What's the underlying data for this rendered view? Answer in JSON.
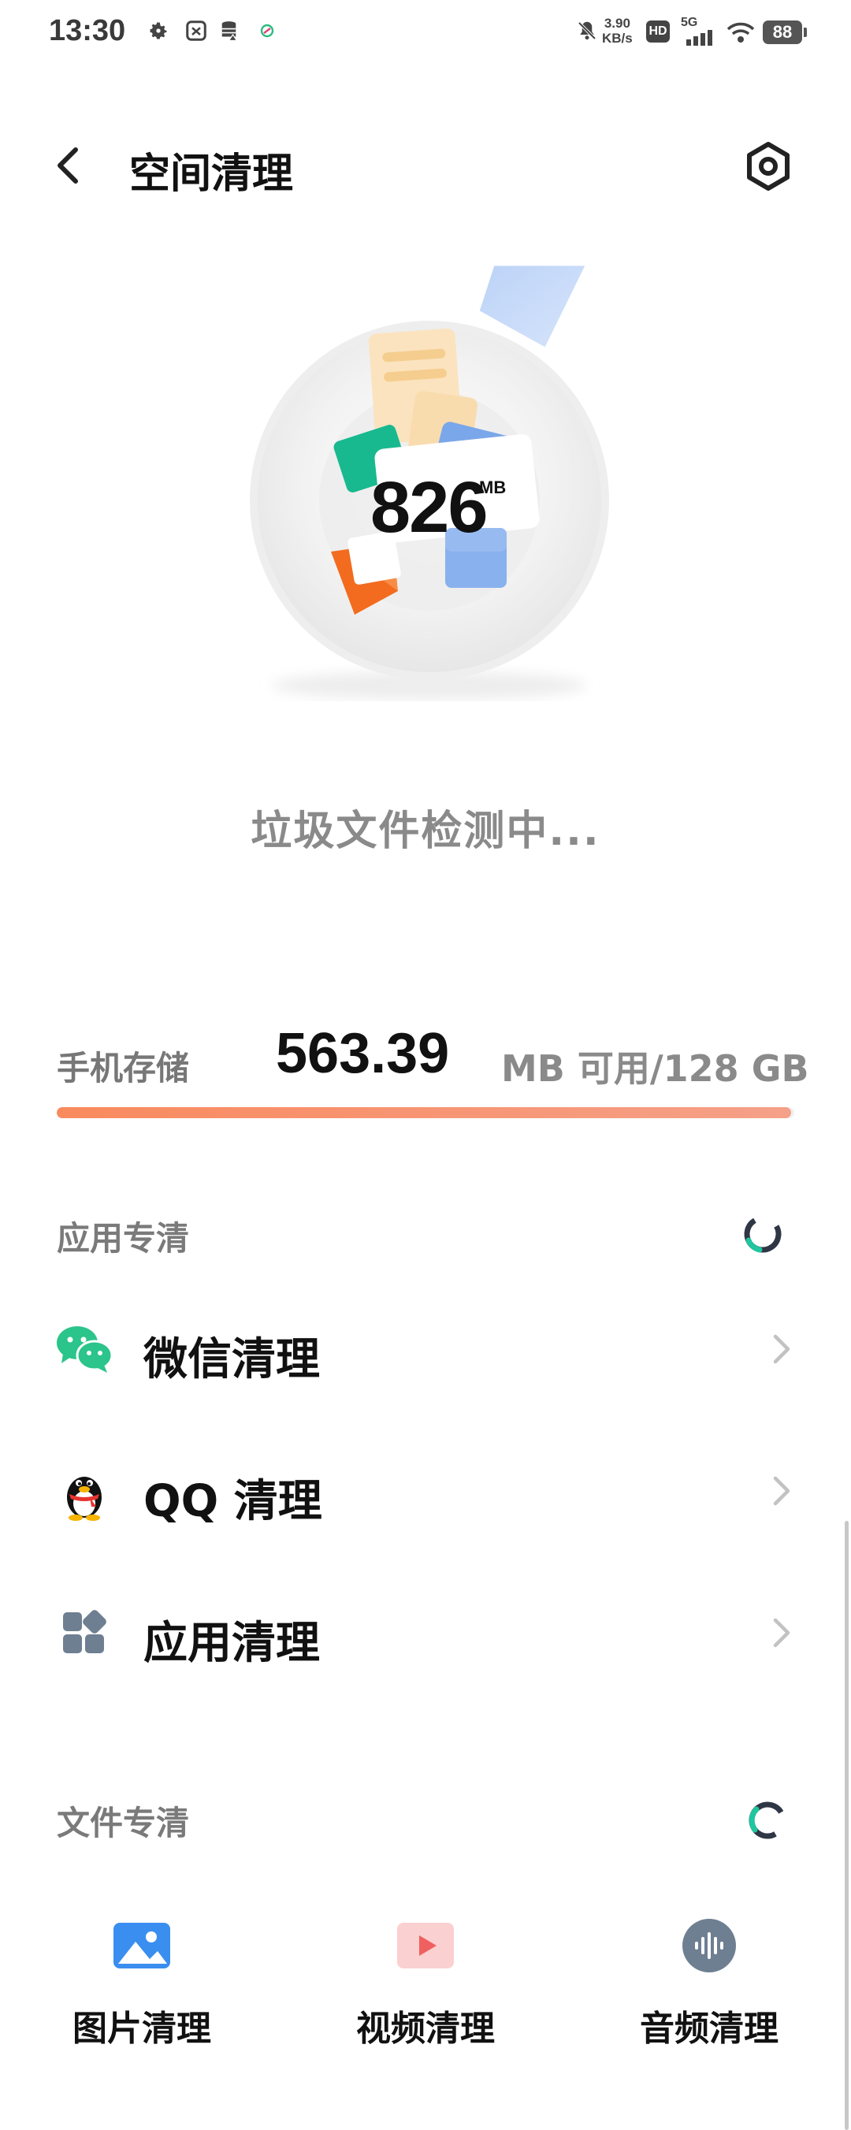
{
  "status_bar": {
    "time": "13:30",
    "net_speed_value": "3.90",
    "net_speed_unit": "KB/s",
    "hd_label": "HD",
    "signal_label": "5G",
    "battery": "88",
    "icons": [
      "settings-gear-icon",
      "screenshot-icon",
      "storage-icon",
      "vpn-icon",
      "mute-icon",
      "wifi-icon",
      "signal-icon"
    ]
  },
  "header": {
    "title": "空间清理",
    "back_icon": "chevron-left-icon",
    "settings_icon": "hexagon-settings-icon"
  },
  "scan": {
    "value": "826",
    "unit": "MB",
    "status": "垃圾文件检测中..."
  },
  "storage": {
    "label": "手机存储",
    "available": "563.39",
    "suffix": "MB 可用/128 GB",
    "used_fraction": 0.996,
    "bar_color": "#f98a5e"
  },
  "app_section": {
    "title": "应用专清",
    "items": [
      {
        "label": "微信清理",
        "icon": "wechat-icon"
      },
      {
        "label": "QQ 清理",
        "icon": "qq-penguin-icon"
      },
      {
        "label": "应用清理",
        "icon": "apps-grid-icon"
      }
    ]
  },
  "file_section": {
    "title": "文件专清",
    "tiles": [
      {
        "label": "图片清理",
        "icon": "image-icon"
      },
      {
        "label": "视频清理",
        "icon": "video-play-icon"
      },
      {
        "label": "音频清理",
        "icon": "audio-wave-icon"
      }
    ]
  },
  "colors": {
    "accent_green": "#1fc6a0",
    "wechat_green": "#2bc48a",
    "image_blue": "#3a8ef0",
    "video_red": "#f06060",
    "audio_gray": "#6f7f92"
  }
}
